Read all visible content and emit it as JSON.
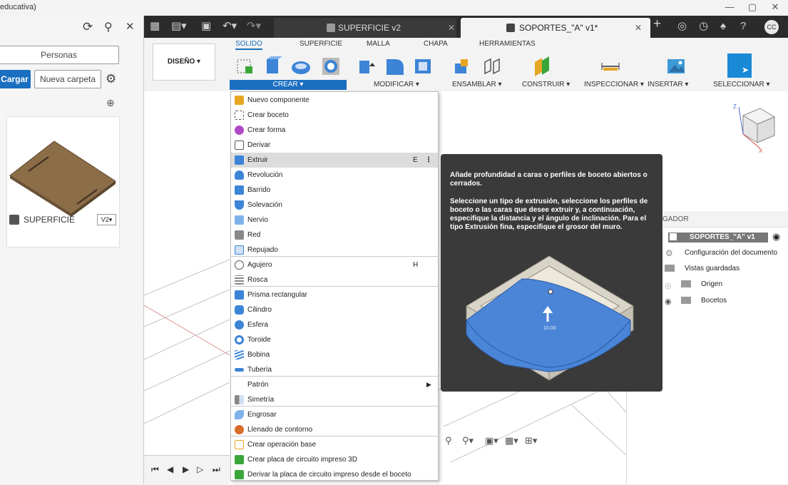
{
  "window": {
    "title_fragment": "educativa)",
    "minimize": "—",
    "maximize": "▢",
    "close": "✕"
  },
  "data_panel": {
    "refresh": "⟳",
    "search": "⚲",
    "close": "✕",
    "people_tab": "Personas",
    "upload": "Cargar",
    "new_folder": "Nueva carpeta",
    "settings": "⚙",
    "globe": "⊕",
    "file_name": "SUPERFICIE",
    "file_version": "V2▾"
  },
  "tabs": {
    "tab1_label": "SUPERFICIE v2",
    "tab1_close": "✕",
    "tab2_label": "SOPORTES_\"A\" v1*",
    "tab2_close": "✕",
    "new_tab": "+"
  },
  "ribbon": {
    "workspace": "DISEÑO ▾",
    "tabs": [
      "SOLIDO",
      "SUPERFICIE",
      "MALLA",
      "CHAPA",
      "HERRAMIENTAS"
    ],
    "groups": {
      "crear": "CREAR ▾",
      "modificar": "MODIFICAR ▾",
      "ensamblar": "ENSAMBLAR ▾",
      "construir": "CONSTRUIR ▾",
      "inspeccionar": "INSPECCIONAR ▾",
      "insertar": "INSERTAR ▾",
      "seleccionar": "SELECCIONAR ▾"
    }
  },
  "menu": {
    "items": [
      {
        "label": "Nuevo componente",
        "shortcut": ""
      },
      {
        "label": "Crear boceto",
        "shortcut": ""
      },
      {
        "label": "Crear forma",
        "shortcut": ""
      },
      {
        "label": "Derivar",
        "shortcut": ""
      },
      {
        "label": "Extruir",
        "shortcut": "E"
      },
      {
        "label": "Revolución",
        "shortcut": ""
      },
      {
        "label": "Barrido",
        "shortcut": ""
      },
      {
        "label": "Solevación",
        "shortcut": ""
      },
      {
        "label": "Nervio",
        "shortcut": ""
      },
      {
        "label": "Red",
        "shortcut": ""
      },
      {
        "label": "Repujado",
        "shortcut": ""
      },
      {
        "label": "Agujero",
        "shortcut": "H"
      },
      {
        "label": "Rosca",
        "shortcut": ""
      },
      {
        "label": "Prisma rectangular",
        "shortcut": ""
      },
      {
        "label": "Cilindro",
        "shortcut": ""
      },
      {
        "label": "Esfera",
        "shortcut": ""
      },
      {
        "label": "Toroide",
        "shortcut": ""
      },
      {
        "label": "Bobina",
        "shortcut": ""
      },
      {
        "label": "Tubería",
        "shortcut": ""
      },
      {
        "label": "Patrón",
        "shortcut": ""
      },
      {
        "label": "Simetría",
        "shortcut": ""
      },
      {
        "label": "Engrosar",
        "shortcut": ""
      },
      {
        "label": "Llenado de contorno",
        "shortcut": ""
      },
      {
        "label": "Crear operación base",
        "shortcut": ""
      },
      {
        "label": "Crear placa de circuito impreso 3D",
        "shortcut": ""
      },
      {
        "label": "Derivar la placa de circuito impreso desde el boceto",
        "shortcut": ""
      }
    ],
    "more": "⋮",
    "submenu_arrow": "▶"
  },
  "tooltip": {
    "summary": "Añade profundidad a caras o perfiles de boceto abiertos o cerrados.",
    "details": "Seleccione un tipo de extrusión, seleccione los perfiles de boceto o las caras que desee extruir y, a continuación, especifique la distancia y el ángulo de inclinación. Para el tipo Extrusión fina, especifique el grosor del muro.",
    "dimension": "10.00"
  },
  "browser": {
    "title": "GADOR",
    "root": "SOPORTES_\"A\" v1",
    "items": [
      "Configuración del documento",
      "Vistas guardadas",
      "Origen",
      "Bocetos"
    ]
  },
  "viewcube": {
    "z": "Z",
    "x": "X"
  },
  "colors": {
    "accent": "#1a6fc0",
    "tab_bar": "#2b2b2b",
    "tooltip_bg": "#3a3a3a",
    "highlight_row": "#dcdcdc",
    "face_blue": "#4a85d8",
    "wood": "#8b6d47"
  }
}
